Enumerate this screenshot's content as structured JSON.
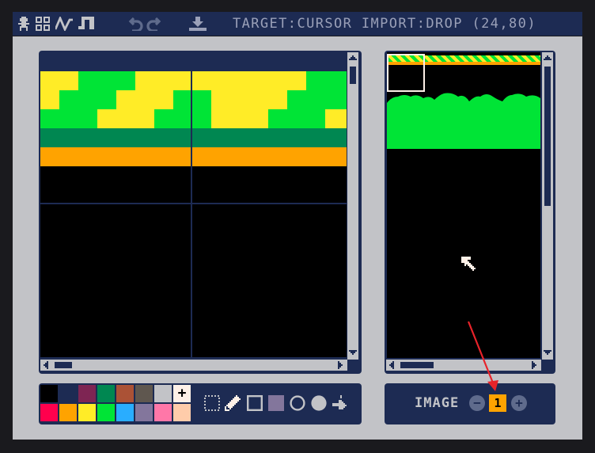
{
  "toolbar": {
    "icons": [
      "sprite-editor-icon",
      "map-grid-icon",
      "sfx-wave-icon",
      "music-note-icon",
      "undo-icon",
      "redo-icon",
      "export-icon"
    ],
    "status_text": "TARGET:CURSOR IMPORT:DROP (24,80)"
  },
  "palette": {
    "colors": [
      "#000000",
      "#1d2b53",
      "#7e2553",
      "#008751",
      "#ab5236",
      "#5f574f",
      "#c2c3c7",
      "#fff1e8",
      "#ff004d",
      "#ffa300",
      "#ffec27",
      "#00e436",
      "#29adff",
      "#83769c",
      "#ff77a8",
      "#ffccaa"
    ],
    "selected_marker": "+"
  },
  "tools": [
    "select-tool",
    "pencil-tool",
    "rect-outline-tool",
    "rect-fill-tool",
    "circle-outline-tool",
    "circle-fill-tool",
    "fill-tool"
  ],
  "image_selector": {
    "label": "IMAGE",
    "value": "1",
    "minus": "−",
    "plus": "+"
  },
  "colors": {
    "green": "#00e436",
    "yellow": "#ffec27",
    "dark_green": "#008751",
    "orange": "#ffa300",
    "navy": "#1d2b53",
    "grey": "#c2c3c7"
  }
}
